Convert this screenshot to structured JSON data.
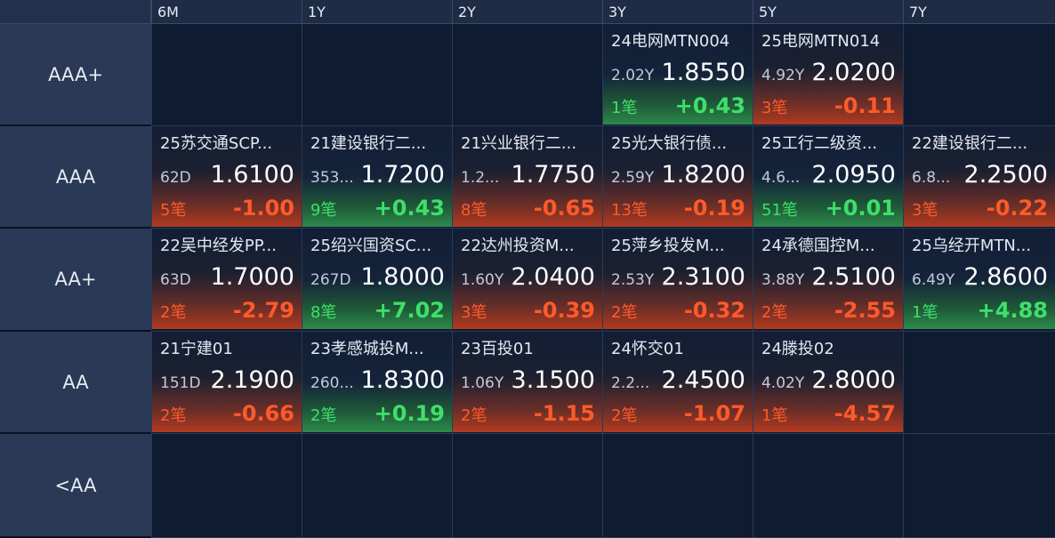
{
  "columns": [
    "6M",
    "1Y",
    "2Y",
    "3Y",
    "5Y",
    "7Y"
  ],
  "rows": [
    {
      "rating": "AAA+",
      "cells": [
        null,
        null,
        null,
        {
          "name": "24电网MTN004",
          "maturity": "2.02Y",
          "yield": "1.8550",
          "count": "1笔",
          "change": "+0.43",
          "direction": "up"
        },
        {
          "name": "25电网MTN014",
          "maturity": "4.92Y",
          "yield": "2.0200",
          "count": "3笔",
          "change": "-0.11",
          "direction": "down"
        },
        null
      ]
    },
    {
      "rating": "AAA",
      "cells": [
        {
          "name": "25苏交通SCP...",
          "maturity": "62D",
          "yield": "1.6100",
          "count": "5笔",
          "change": "-1.00",
          "direction": "down"
        },
        {
          "name": "21建设银行二...",
          "maturity": "353...",
          "yield": "1.7200",
          "count": "9笔",
          "change": "+0.43",
          "direction": "up"
        },
        {
          "name": "21兴业银行二...",
          "maturity": "1.2...",
          "yield": "1.7750",
          "count": "8笔",
          "change": "-0.65",
          "direction": "down"
        },
        {
          "name": "25光大银行债...",
          "maturity": "2.59Y",
          "yield": "1.8200",
          "count": "13笔",
          "change": "-0.19",
          "direction": "down"
        },
        {
          "name": "25工行二级资...",
          "maturity": "4.6...",
          "yield": "2.0950",
          "count": "51笔",
          "change": "+0.01",
          "direction": "up"
        },
        {
          "name": "22建设银行二...",
          "maturity": "6.8...",
          "yield": "2.2500",
          "count": "3笔",
          "change": "-0.22",
          "direction": "down"
        }
      ]
    },
    {
      "rating": "AA+",
      "cells": [
        {
          "name": "22吴中经发PP...",
          "maturity": "63D",
          "yield": "1.7000",
          "count": "2笔",
          "change": "-2.79",
          "direction": "down"
        },
        {
          "name": "25绍兴国资SC...",
          "maturity": "267D",
          "yield": "1.8000",
          "count": "8笔",
          "change": "+7.02",
          "direction": "up"
        },
        {
          "name": "22达州投资M...",
          "maturity": "1.60Y",
          "yield": "2.0400",
          "count": "3笔",
          "change": "-0.39",
          "direction": "down"
        },
        {
          "name": "25萍乡投发M...",
          "maturity": "2.53Y",
          "yield": "2.3100",
          "count": "2笔",
          "change": "-0.32",
          "direction": "down"
        },
        {
          "name": "24承德国控M...",
          "maturity": "3.88Y",
          "yield": "2.5100",
          "count": "2笔",
          "change": "-2.55",
          "direction": "down"
        },
        {
          "name": "25乌经开MTN...",
          "maturity": "6.49Y",
          "yield": "2.8600",
          "count": "1笔",
          "change": "+4.88",
          "direction": "up"
        }
      ]
    },
    {
      "rating": "AA",
      "cells": [
        {
          "name": "21宁建01",
          "maturity": "151D",
          "yield": "2.1900",
          "count": "2笔",
          "change": "-0.66",
          "direction": "down"
        },
        {
          "name": "23孝感城投M...",
          "maturity": "260...",
          "yield": "1.8300",
          "count": "2笔",
          "change": "+0.19",
          "direction": "up"
        },
        {
          "name": "23百投01",
          "maturity": "1.06Y",
          "yield": "3.1500",
          "count": "2笔",
          "change": "-1.15",
          "direction": "down"
        },
        {
          "name": "24怀交01",
          "maturity": "2.2...",
          "yield": "2.4500",
          "count": "2笔",
          "change": "-1.07",
          "direction": "down"
        },
        {
          "name": "24滕投02",
          "maturity": "4.02Y",
          "yield": "2.8000",
          "count": "1笔",
          "change": "-4.57",
          "direction": "down"
        },
        null
      ]
    },
    {
      "rating": "<AA",
      "cells": [
        null,
        null,
        null,
        null,
        null,
        null
      ]
    }
  ],
  "colors": {
    "up": "#3ee06a",
    "down": "#ff5a2a",
    "background": "#0f1a2e",
    "header": "#2a3a56"
  }
}
